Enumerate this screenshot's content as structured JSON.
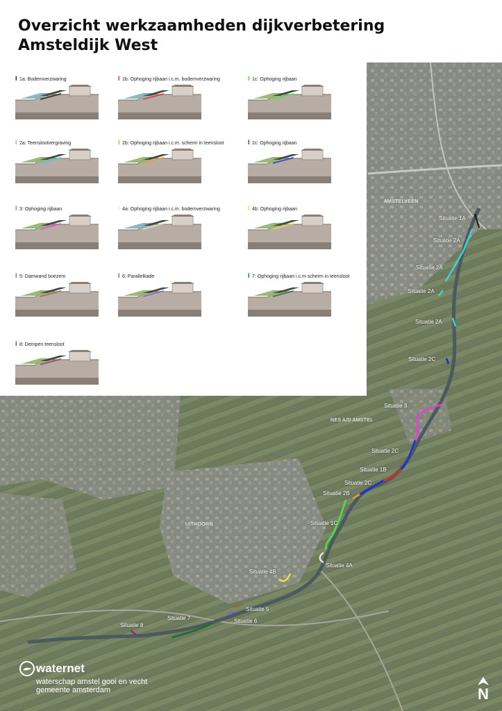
{
  "title": {
    "line1": "Overzicht werkzaamheden dijkverbetering",
    "line2": "Amsteldijk West"
  },
  "colors": {
    "1a": "#111111",
    "1b": "#e0252b",
    "1c": "#4de04a",
    "2a": "#3ad3d8",
    "2b": "#f29a2e",
    "2c": "#1a2fd8",
    "3": "#e43fd6",
    "4a": "#e8e4d4",
    "4b": "#e8e23a",
    "5": "#8a6a4a",
    "6": "#7a5ad8",
    "7": "#1e6a2a",
    "8": "#9a2a6a"
  },
  "legend": [
    {
      "key": "1a",
      "label": "1a: Bodemverzwaring"
    },
    {
      "key": "1b",
      "label": "1b: Ophoging rijbaan i.c.m. bodemverzwaring"
    },
    {
      "key": "1c",
      "label": "1c: Ophoging rijbaan"
    },
    {
      "key": "2a",
      "label": "2a: Teenslootvergraving"
    },
    {
      "key": "2b",
      "label": "2b: Ophoging rijbaan i.c.m. scherm in teensloot"
    },
    {
      "key": "2c",
      "label": "2c: Ophoging rijbaan"
    },
    {
      "key": "3",
      "label": "3: Ophoging rijbaan"
    },
    {
      "key": "4a",
      "label": "4a: Ophoging rijbaan i.c.m. bodemverzwaring"
    },
    {
      "key": "4b",
      "label": "4b: Ophoging rijbaan"
    },
    {
      "key": "5",
      "label": "5: Damwand boezem"
    },
    {
      "key": "6",
      "label": "6: Parallelkade"
    },
    {
      "key": "7",
      "label": "7: Ophoging rijbaan i.c.m scherm in teensloot"
    },
    {
      "key": "8",
      "label": "8: Dempen teensloot"
    }
  ],
  "places": {
    "amstelveen": "AMSTELVEEN",
    "nes": "NES A/D AMSTEL",
    "uithoorn": "UITHOORN"
  },
  "situations": {
    "s1a": "Situatie 1A",
    "s2a_1": "Situatie 2A",
    "s2a_2": "Situatie 2A",
    "s2a_3": "Situatie 2A",
    "s2a_4": "Situatie 2A",
    "s2c_1": "Situatie 2C",
    "s3": "Situatie 3",
    "s2c_2": "Situatie 2C",
    "s1b": "Situatie 1B",
    "s2c_3": "Situatie 2C",
    "s2b": "Situatie 2B",
    "s1c": "Situatie 1C",
    "s4a": "Situatie 4A",
    "s4b": "Situatie 4B",
    "s5": "Situatie 5",
    "s6": "Situatie 6",
    "s7": "Situatie 7",
    "s8": "Situatie 8"
  },
  "logo": {
    "name": "waternet",
    "sub1": "waterschap amstel gooi en vecht",
    "sub2": "gemeente amsterdam"
  },
  "north": "N"
}
